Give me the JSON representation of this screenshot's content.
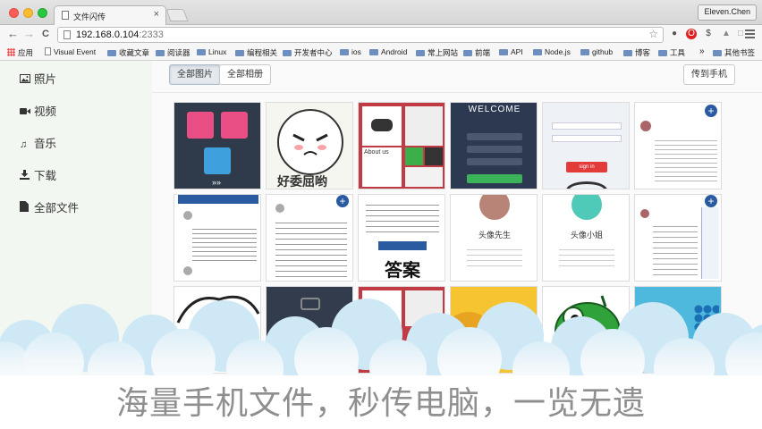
{
  "browser": {
    "tab_title": "文件闪传",
    "tab_close": "×",
    "profile": "Eleven.Chen",
    "url_host": "192.168.0.104",
    "url_port": ":2333",
    "back": "←",
    "forward": "→",
    "reload": "C",
    "star": "☆",
    "bookmarks": [
      {
        "label": "应用",
        "icon": "apps-icon"
      },
      {
        "label": "Visual Event",
        "icon": "page-icon"
      },
      {
        "label": "收藏文章",
        "icon": "folder-icon"
      },
      {
        "label": "阅读器",
        "icon": "folder-icon"
      },
      {
        "label": "Linux",
        "icon": "folder-icon"
      },
      {
        "label": "编程相关",
        "icon": "folder-icon"
      },
      {
        "label": "开发者中心",
        "icon": "folder-icon"
      },
      {
        "label": "ios",
        "icon": "folder-icon"
      },
      {
        "label": "Android",
        "icon": "folder-icon"
      },
      {
        "label": "常上网站",
        "icon": "folder-icon"
      },
      {
        "label": "前端",
        "icon": "folder-icon"
      },
      {
        "label": "API",
        "icon": "folder-icon"
      },
      {
        "label": "Node.js",
        "icon": "folder-icon"
      },
      {
        "label": "github",
        "icon": "folder-icon"
      },
      {
        "label": "博客",
        "icon": "folder-icon"
      },
      {
        "label": "工具",
        "icon": "folder-icon"
      }
    ],
    "bookmarks_overflow": "»",
    "other_bookmarks": "其他书签"
  },
  "sidebar": {
    "items": [
      {
        "label": "照片",
        "icon": "photo-icon"
      },
      {
        "label": "视频",
        "icon": "video-icon"
      },
      {
        "label": "音乐",
        "icon": "music-icon"
      },
      {
        "label": "下载",
        "icon": "download-icon"
      },
      {
        "label": "全部文件",
        "icon": "file-icon"
      }
    ]
  },
  "toolbar": {
    "all_photos": "全部图片",
    "all_albums": "全部相册",
    "send_to_phone": "传到手机"
  },
  "thumbs": {
    "sticker_caption": "好委屈哟",
    "welcome": "WELCOME",
    "answer": "答案",
    "profile_mr": "头像先生",
    "profile_miss": "头像小姐",
    "about_us": "About us",
    "login": "sign in"
  },
  "tagline": "海量手机文件，秒传电脑，一览无遗"
}
